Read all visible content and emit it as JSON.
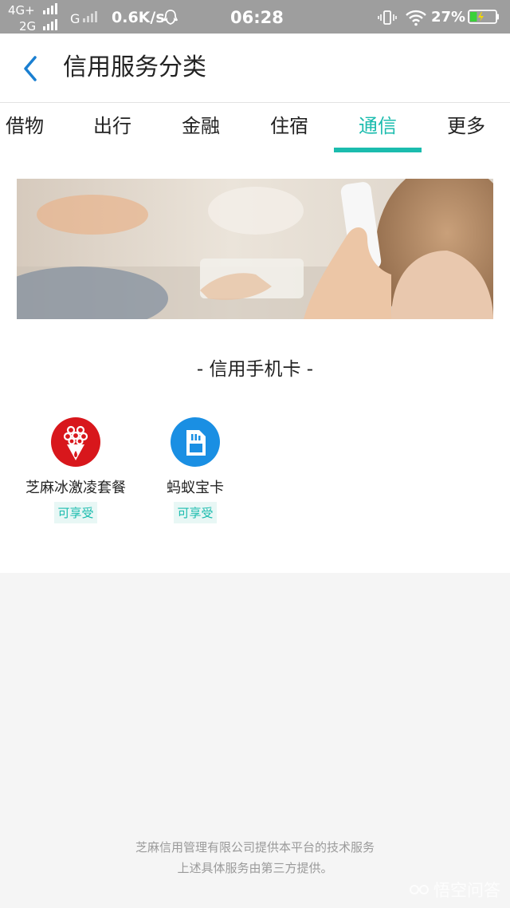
{
  "status_bar": {
    "net1": "4G+",
    "net2": "2G",
    "net3": "G",
    "speed": "0.6K/s",
    "time": "06:28",
    "battery_pct": "27%",
    "battery_level": 0.27,
    "icons": [
      "signal-icon",
      "qq-icon",
      "vibrate-icon",
      "wifi-icon",
      "battery-icon"
    ]
  },
  "header": {
    "title": "信用服务分类"
  },
  "tabs": [
    {
      "label": "借物",
      "active": false
    },
    {
      "label": "出行",
      "active": false
    },
    {
      "label": "金融",
      "active": false
    },
    {
      "label": "住宿",
      "active": false
    },
    {
      "label": "通信",
      "active": true
    },
    {
      "label": "更多",
      "active": false
    }
  ],
  "section": {
    "title": "- 信用手机卡 -"
  },
  "services": [
    {
      "name": "芝麻冰激凌套餐",
      "badge": "可享受",
      "icon": "china-unicom-icon",
      "icon_color": "#d8171c"
    },
    {
      "name": "蚂蚁宝卡",
      "badge": "可享受",
      "icon": "sim-card-icon",
      "icon_color": "#1a8fe3"
    }
  ],
  "footer": {
    "line1": "芝麻信用管理有限公司提供本平台的技术服务",
    "line2": "上述具体服务由第三方提供。"
  },
  "watermark": {
    "text": "悟空问答"
  },
  "colors": {
    "accent": "#1bbcae",
    "back_arrow": "#1a7fd1",
    "status_bar": "#9e9e9e"
  }
}
